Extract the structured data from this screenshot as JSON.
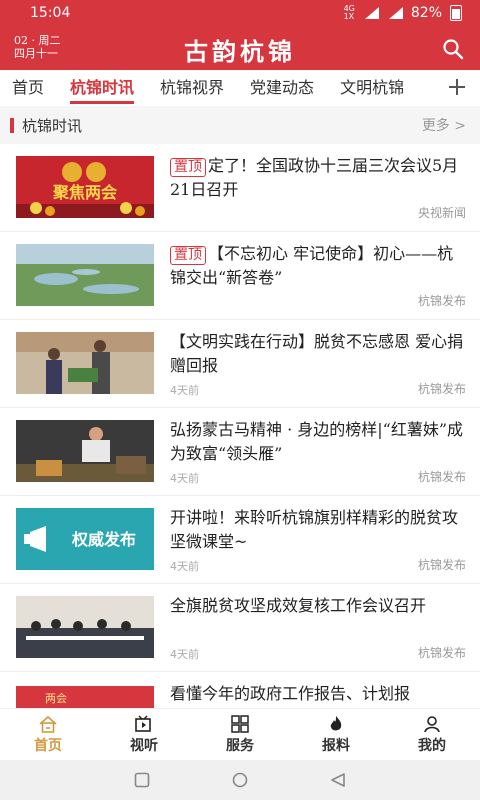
{
  "status_bar": {
    "time": "15:04",
    "network_top": "4G",
    "network_bottom": "1X",
    "battery": "82%"
  },
  "header": {
    "date_line1": "02 · 周二",
    "date_line2": "四月十一",
    "title": "古韵杭锦"
  },
  "tabs": [
    "首页",
    "杭锦时讯",
    "杭锦视界",
    "党建动态",
    "文明杭锦"
  ],
  "active_tab": 1,
  "section": {
    "title": "杭锦时讯",
    "more": "更多 >"
  },
  "pin_label": "置顶",
  "articles": [
    {
      "pinned": true,
      "title": "定了！全国政协十三届三次会议5月21日召开",
      "time": "",
      "source": "央视新闻"
    },
    {
      "pinned": true,
      "title": "【不忘初心 牢记使命】初心——杭锦交出“新答卷”",
      "time": "",
      "source": "杭锦发布"
    },
    {
      "pinned": false,
      "title": "【文明实践在行动】脱贫不忘感恩 爱心捐赠回报",
      "time": "4天前",
      "source": "杭锦发布"
    },
    {
      "pinned": false,
      "title": "弘扬蒙古马精神 · 身边的榜样|“红薯妹”成为致富“领头雁”",
      "time": "4天前",
      "source": "杭锦发布"
    },
    {
      "pinned": false,
      "title": "开讲啦！来聆听杭锦旗别样精彩的脱贫攻坚微课堂~",
      "time": "4天前",
      "source": "杭锦发布"
    },
    {
      "pinned": false,
      "title": "全旗脱贫攻坚成效复核工作会议召开",
      "time": "4天前",
      "source": "杭锦发布"
    },
    {
      "pinned": false,
      "title": "看懂今年的政府工作报告、计划报",
      "time": "",
      "source": ""
    }
  ],
  "thumb_texts": {
    "t1": "聚焦两会",
    "t5": "权威发布",
    "t7": "两会"
  },
  "bottom_nav": [
    "首页",
    "视听",
    "服务",
    "报料",
    "我的"
  ],
  "colors": {
    "brand_red": "#d6373f",
    "active_nav": "#d29a40"
  }
}
